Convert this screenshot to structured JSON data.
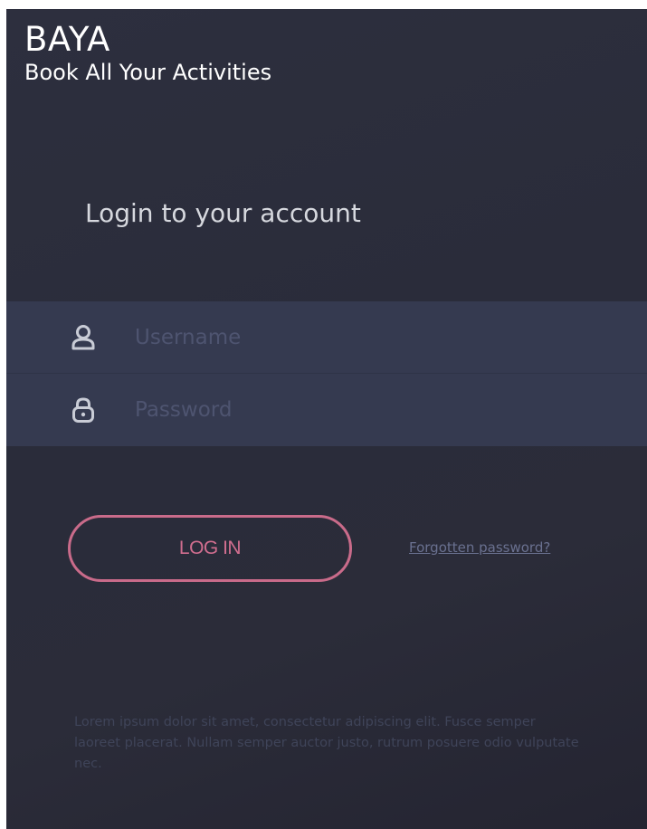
{
  "brand": {
    "name": "BAYA",
    "tagline": "Book All Your Activities"
  },
  "login": {
    "heading": "Login to your account",
    "username": {
      "placeholder": "Username",
      "value": "",
      "icon": "user-icon"
    },
    "password": {
      "placeholder": "Password",
      "value": "",
      "icon": "lock-icon"
    },
    "submit_label": "LOG IN",
    "forgot_label": "Forgotten password?"
  },
  "footer": {
    "text": "Lorem ipsum dolor sit amet, consectetur adipiscing elit. Fusce semper laoreet placerat. Nullam semper auctor justo, rutrum posuere odio vulputate nec."
  },
  "colors": {
    "background": "#2b2c3a",
    "fields_band": "#353a50",
    "accent": "#d16e8f",
    "link": "#6a7190",
    "icon": "#c9ccd6"
  }
}
